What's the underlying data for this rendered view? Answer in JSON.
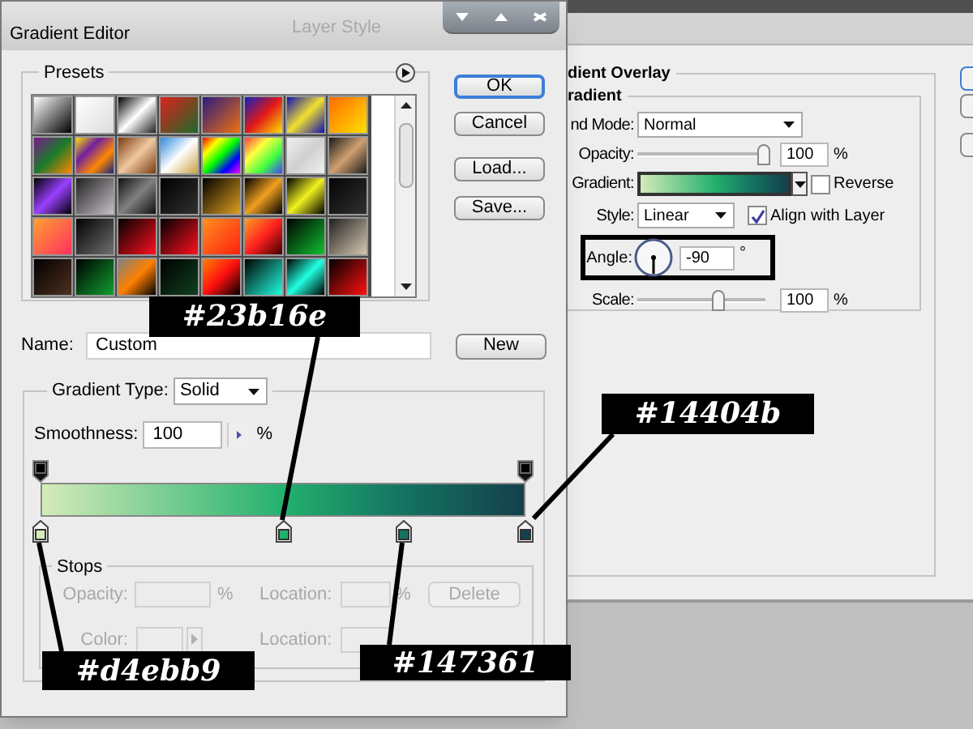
{
  "background_window_title": "Layer Style",
  "gradient_editor": {
    "title": "Gradient Editor",
    "presets_label": "Presets",
    "buttons": [
      {
        "label": "OK",
        "default": true
      },
      {
        "label": "Cancel",
        "default": false
      },
      {
        "label": "Load...",
        "default": false
      },
      {
        "label": "Save...",
        "default": false
      }
    ],
    "name": {
      "label": "Name:",
      "value": "Custom"
    },
    "new_button": "New",
    "gradient_type": {
      "label": "Gradient Type:",
      "value": "Solid"
    },
    "smoothness": {
      "label": "Smoothness:",
      "value": "100",
      "unit": "%"
    },
    "opacity_stops": [
      {
        "level": 0
      },
      {
        "level": 1
      }
    ],
    "color_stops": [
      {
        "color": "#d4ebb9",
        "level": 0
      },
      {
        "color": "#23b16e",
        "level": 0.5
      },
      {
        "color": "#147361",
        "level": 0.75
      },
      {
        "color": "#14404b",
        "level": 1
      }
    ],
    "stops": {
      "label": "Stops",
      "disabled": true,
      "opacity_label": "Opacity:",
      "opacity_unit": "%",
      "location_label": "Location:",
      "location_unit": "%",
      "delete": "Delete",
      "color_label": "Color:",
      "color_location_label": "Location:"
    }
  },
  "layer_style": {
    "section": "dient Overlay",
    "group": "radient",
    "blend_mode": {
      "label": "nd Mode:",
      "value": "Normal"
    },
    "opacity": {
      "label": "Opacity:",
      "level": 1,
      "value": "100",
      "unit": "%"
    },
    "gradient": {
      "label": "Gradient:"
    },
    "reverse": {
      "label": "Reverse",
      "checked": false
    },
    "style": {
      "label": "Style:",
      "value": "Linear"
    },
    "align_with_layer": {
      "label": "Align with Layer",
      "checked": true
    },
    "angle": {
      "label": "Angle:",
      "value": "-90",
      "unit": "°"
    },
    "scale": {
      "label": "Scale:",
      "level": 0.65,
      "value": "100",
      "unit": "%"
    }
  },
  "callouts": [
    {
      "text": "#d4ebb9"
    },
    {
      "text": "#23b16e"
    },
    {
      "text": "#147361"
    },
    {
      "text": "#14404b"
    }
  ]
}
